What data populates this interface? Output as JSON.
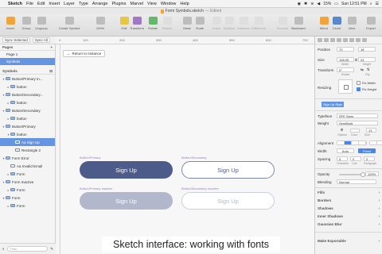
{
  "menubar": {
    "app": "Sketch",
    "menus": [
      "File",
      "Edit",
      "Insert",
      "Layer",
      "Type",
      "Arrange",
      "Plugins",
      "Marvel",
      "View",
      "Window",
      "Help"
    ],
    "battery": "15%",
    "clock": "Sun 12:51 PM"
  },
  "window": {
    "title": "Form Symbols.sketch",
    "edited": "— Edited"
  },
  "toolbar": {
    "insert": "Insert",
    "group": "Group",
    "ungroup": "Ungroup",
    "create_symbol": "Create Symbol",
    "zoom": "100%",
    "edit": "Edit",
    "transform": "Transform",
    "rotate": "Rotate",
    "flatten": "Flatten",
    "mask": "Mask",
    "scale": "Scale",
    "union": "Union",
    "subtract": "Subtract",
    "intersect": "Intersect",
    "difference": "Difference",
    "forward": "Forward",
    "backward": "Backward",
    "mirror": "Mirror",
    "cloud": "Cloud",
    "view": "View",
    "export": "Export"
  },
  "syncbar": {
    "sync_selected": "Sync Selected",
    "sync_all": "Sync All"
  },
  "ruler": [
    "0",
    "100",
    "200",
    "300",
    "400",
    "500",
    "600",
    "700"
  ],
  "sidebar": {
    "pages_header": "Pages",
    "pages": [
      {
        "label": "Page 1"
      },
      {
        "label": "Symbols"
      }
    ],
    "layers_header": "Symbols",
    "layers": [
      {
        "label": "Button/Primary In...",
        "indent": 0,
        "tri": "▾",
        "folder": true
      },
      {
        "label": "button",
        "indent": 1,
        "tri": "▸",
        "folder": true
      },
      {
        "label": "Button/Secondary...",
        "indent": 0,
        "tri": "▾",
        "folder": true
      },
      {
        "label": "button",
        "indent": 1,
        "tri": "▸",
        "folder": true
      },
      {
        "label": "Button/Secondary",
        "indent": 0,
        "tri": "▾",
        "folder": true
      },
      {
        "label": "button",
        "indent": 1,
        "tri": "▸",
        "folder": true
      },
      {
        "label": "Button/Primary",
        "indent": 0,
        "tri": "▾",
        "folder": true
      },
      {
        "label": "button",
        "indent": 1,
        "tri": "▾",
        "folder": true
      },
      {
        "label": "Aa Sign Up",
        "indent": 2,
        "tri": "",
        "folder": false
      },
      {
        "label": "Rectangle 2",
        "indent": 2,
        "tri": "",
        "folder": false
      },
      {
        "label": "Form Error",
        "indent": 0,
        "tri": "▾",
        "folder": true
      },
      {
        "label": "Aa Invalid Email",
        "indent": 1,
        "tri": "",
        "folder": false
      },
      {
        "label": "Form",
        "indent": 1,
        "tri": "▸",
        "folder": true
      },
      {
        "label": "Form Inactive",
        "indent": 0,
        "tri": "▾",
        "folder": true
      },
      {
        "label": "Form",
        "indent": 1,
        "tri": "▸",
        "folder": true
      },
      {
        "label": "Form",
        "indent": 0,
        "tri": "▾",
        "folder": true
      },
      {
        "label": "Form",
        "indent": 1,
        "tri": "▸",
        "folder": true
      }
    ],
    "filter_placeholder": "Filter"
  },
  "canvas": {
    "back_label": "Return to Instance",
    "artboards": [
      {
        "label": "Button/Primary",
        "button_text": "Sign Up",
        "style": "btn-primary"
      },
      {
        "label": "Button/Secondary",
        "button_text": "Sign Up",
        "style": "btn-secondary"
      },
      {
        "label": "Button/Primary Inactive",
        "button_text": "Sign Up",
        "style": "btn-primary-inactive"
      },
      {
        "label": "Button/Secondary Inactive",
        "button_text": "Sign Up",
        "style": "btn-secondary-inactive"
      }
    ]
  },
  "inspector": {
    "position_label": "Position",
    "x": "72",
    "y": "18",
    "size_label": "Size",
    "width": "108.05",
    "height": "24",
    "width_sub": "Width",
    "height_sub": "Height",
    "transform_label": "Transform",
    "rotate_value": "0°",
    "rotate_sub": "Rotate",
    "flip_sub": "Flip",
    "resizing_label": "Resizing",
    "fix_width": "Fix Width",
    "fix_height": "Fix Height",
    "text_style": "Sign Up Style",
    "typeface_label": "Typeface",
    "typeface": "SFE Sans",
    "weight_label": "Weight",
    "weight": "SemiBold",
    "font_size": "13",
    "options_sub": "Options",
    "color_sub": "Color",
    "size_sub": "Size",
    "alignment_label": "Alignment",
    "width_label": "Width",
    "width_auto": "Auto",
    "width_fixed": "Fixed",
    "spacing_label": "Spacing",
    "char_spacing": "0",
    "line_spacing": "0",
    "para_spacing": "0",
    "char_sub": "Character",
    "line_sub": "Line",
    "para_sub": "Paragraph",
    "opacity_label": "Opacity",
    "opacity": "100%",
    "opacity_level": 1.0,
    "blending_label": "Blending",
    "blending": "Normal",
    "sections": [
      "Fills",
      "Borders",
      "Shadows",
      "Inner Shadows",
      "Gaussian Blur"
    ],
    "make_exportable": "Make Exportable"
  },
  "caption": "Sketch interface: working with fonts"
}
